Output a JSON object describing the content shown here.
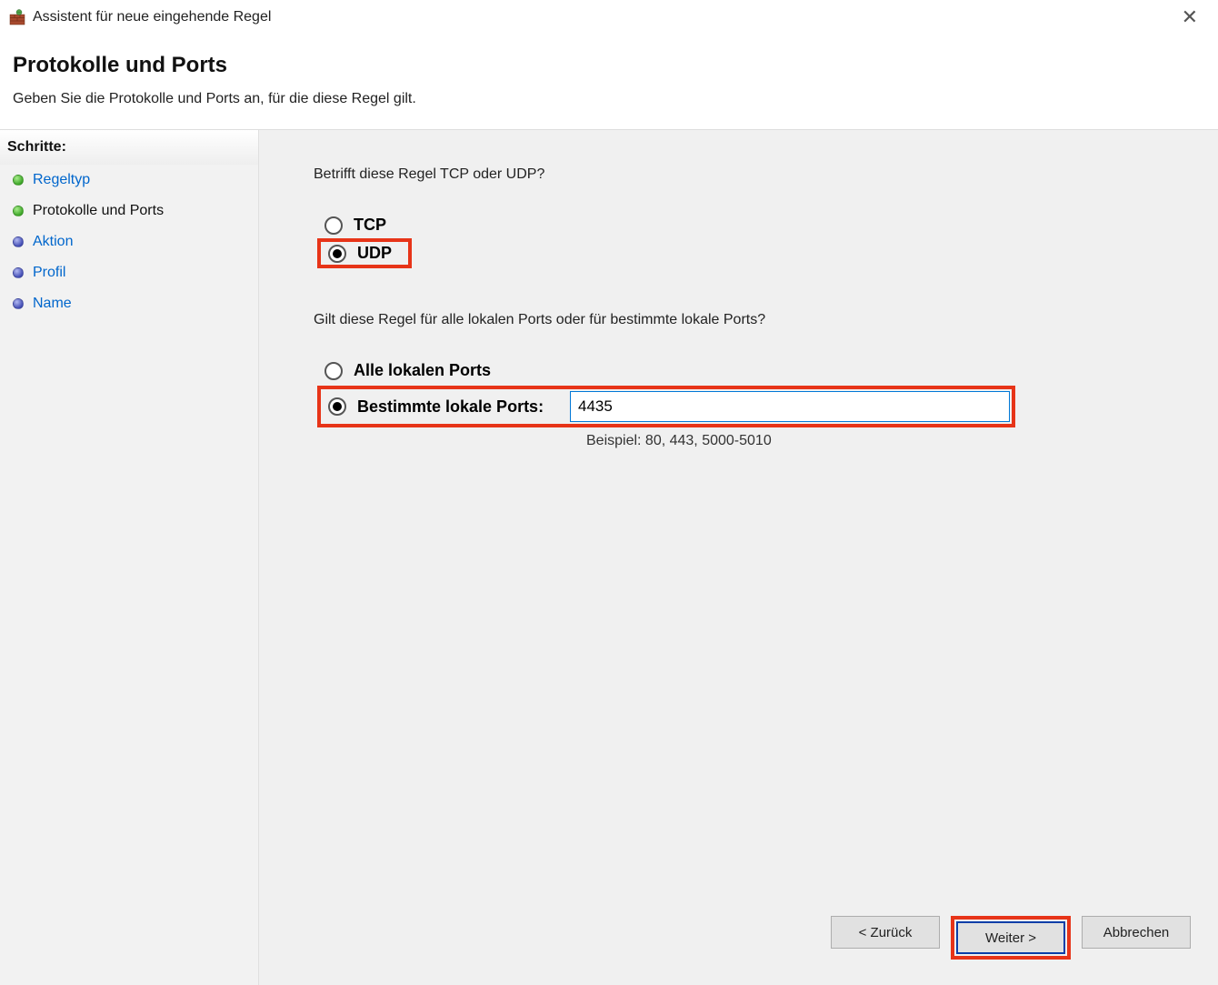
{
  "titlebar": {
    "title": "Assistent für neue eingehende Regel"
  },
  "header": {
    "pageTitle": "Protokolle und Ports",
    "pageDesc": "Geben Sie die Protokolle und Ports an, für die diese Regel gilt."
  },
  "sidebar": {
    "header": "Schritte:",
    "items": [
      {
        "label": "Regeltyp",
        "state": "done"
      },
      {
        "label": "Protokolle und Ports",
        "state": "done"
      },
      {
        "label": "Aktion",
        "state": "pending"
      },
      {
        "label": "Profil",
        "state": "pending"
      },
      {
        "label": "Name",
        "state": "pending"
      }
    ]
  },
  "main": {
    "protocolQuestion": "Betrifft diese Regel TCP oder UDP?",
    "protocol": {
      "tcp": "TCP",
      "udp": "UDP",
      "selected": "udp"
    },
    "portQuestion": "Gilt diese Regel für alle lokalen Ports oder für bestimmte lokale Ports?",
    "ports": {
      "allLabel": "Alle lokalen Ports",
      "specificLabel": "Bestimmte lokale Ports:",
      "selected": "specific",
      "value": "4435",
      "example": "Beispiel: 80, 443, 5000-5010"
    }
  },
  "buttons": {
    "back": "< Zurück",
    "next": "Weiter >",
    "cancel": "Abbrechen"
  }
}
